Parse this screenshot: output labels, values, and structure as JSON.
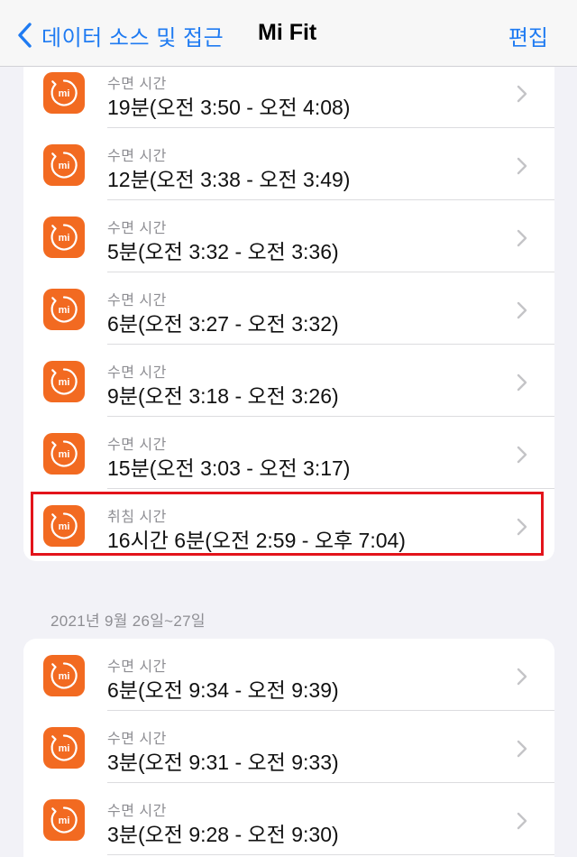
{
  "nav": {
    "back_label": "데이터 소스 및 접근",
    "title": "Mi Fit",
    "edit_label": "편집"
  },
  "groups": [
    {
      "header": "",
      "rows": [
        {
          "kind": "수면 시간",
          "value": "19분(오전 3:50 - 오전 4:08)"
        },
        {
          "kind": "수면 시간",
          "value": "12분(오전 3:38 - 오전 3:49)"
        },
        {
          "kind": "수면 시간",
          "value": "5분(오전 3:32 - 오전 3:36)"
        },
        {
          "kind": "수면 시간",
          "value": "6분(오전 3:27 - 오전 3:32)"
        },
        {
          "kind": "수면 시간",
          "value": "9분(오전 3:18 - 오전 3:26)"
        },
        {
          "kind": "수면 시간",
          "value": "15분(오전 3:03 - 오전 3:17)"
        },
        {
          "kind": "취침 시간",
          "value": "16시간 6분(오전 2:59 - 오후 7:04)"
        }
      ]
    },
    {
      "header": "2021년 9월 26일~27일",
      "rows": [
        {
          "kind": "수면 시간",
          "value": "6분(오전 9:34 - 오전 9:39)"
        },
        {
          "kind": "수면 시간",
          "value": "3분(오전 9:31 - 오전 9:33)"
        },
        {
          "kind": "수면 시간",
          "value": "3분(오전 9:28 - 오전 9:30)"
        }
      ]
    }
  ],
  "icons": {
    "app": "mi-fit-app-icon",
    "row_arrow": "chevron-right-icon",
    "back": "chevron-left-icon"
  },
  "colors": {
    "accent": "#1f7bf2",
    "app_icon": "#f26a21",
    "highlight_box": "#e3141b"
  }
}
